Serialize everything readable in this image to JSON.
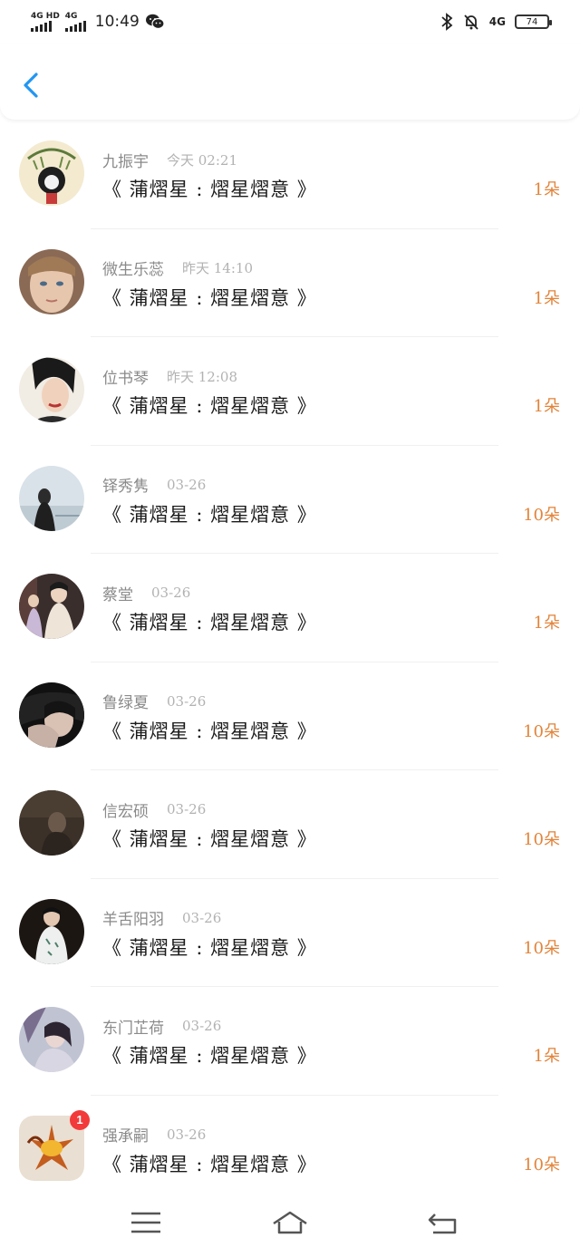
{
  "status_bar": {
    "sim1_label": "4G HD",
    "sim2_label": "4G",
    "time": "10:49",
    "network_right": "4G",
    "battery": "74"
  },
  "list": [
    {
      "name": "九振宇",
      "time": "今天 02:21",
      "title": "《 蒲熠星 : 熠星熠意 》",
      "count": "1朵"
    },
    {
      "name": "微生乐蕊",
      "time": "昨天 14:10",
      "title": "《 蒲熠星 : 熠星熠意 》",
      "count": "1朵"
    },
    {
      "name": "位书琴",
      "time": "昨天 12:08",
      "title": "《 蒲熠星 : 熠星熠意 》",
      "count": "1朵"
    },
    {
      "name": "铎秀隽",
      "time": "03-26",
      "title": "《 蒲熠星 : 熠星熠意 》",
      "count": "10朵"
    },
    {
      "name": "蔡堂",
      "time": "03-26",
      "title": "《 蒲熠星 : 熠星熠意 》",
      "count": "1朵"
    },
    {
      "name": "鲁绿夏",
      "time": "03-26",
      "title": "《 蒲熠星 : 熠星熠意 》",
      "count": "10朵"
    },
    {
      "name": "信宏硕",
      "time": "03-26",
      "title": "《 蒲熠星 : 熠星熠意 》",
      "count": "10朵"
    },
    {
      "name": "羊舌阳羽",
      "time": "03-26",
      "title": "《 蒲熠星 : 熠星熠意 》",
      "count": "10朵"
    },
    {
      "name": "东门芷荷",
      "time": "03-26",
      "title": "《 蒲熠星 : 熠星熠意 》",
      "count": "1朵"
    },
    {
      "name": "强承嗣",
      "time": "03-26",
      "title": "《 蒲熠星 : 熠星熠意 》",
      "count": "10朵",
      "badge": "1"
    }
  ],
  "colors": {
    "accent": "#2196f3",
    "count": "#e2843a",
    "badge": "#f23a3a"
  },
  "icons": {
    "back": "chevron-left-icon",
    "menu": "menu-icon",
    "home": "home-icon",
    "return": "return-icon"
  }
}
